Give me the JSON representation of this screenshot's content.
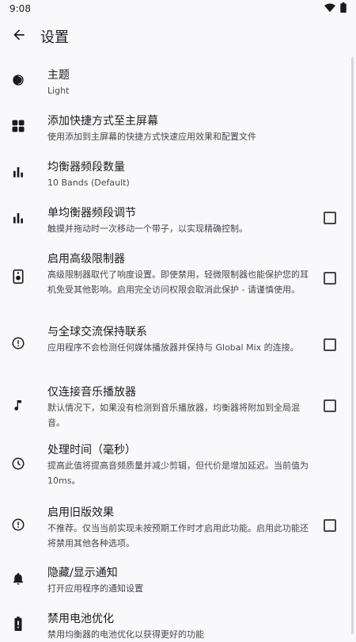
{
  "status_bar": {
    "time": "9:08",
    "wifi_icon": "wifi-icon",
    "battery_icon": "battery-icon"
  },
  "app_bar": {
    "title": "设置",
    "back_icon": "arrow-back-icon"
  },
  "settings": [
    {
      "icon": "theme-contrast-icon",
      "title": "主题",
      "subtitle": "Light",
      "checkbox": false
    },
    {
      "icon": "grid-icon",
      "title": "添加快捷方式至主屏幕",
      "subtitle": "使用添加到主屏幕的快捷方式快速应用效果和配置文件",
      "checkbox": false
    },
    {
      "icon": "bar-chart-icon",
      "title": "均衡器频段数量",
      "subtitle": "10 Bands (Default)",
      "checkbox": false
    },
    {
      "icon": "bar-chart-icon",
      "title": "单均衡器频段调节",
      "subtitle": "触摸并拖动时一次移动一个带子，以实现精确控制。",
      "checkbox": true,
      "checked": false
    },
    {
      "icon": "speaker-icon",
      "title": "启用高级限制器",
      "subtitle": "高级限制器取代了响度设置。即使禁用，轻微限制器也能保护您的耳机免受其他影响。启用完全访问权限会取消此保护 - 请谨慎使用。",
      "checkbox": true,
      "checked": false
    },
    {
      "icon": "info-circle-icon",
      "title": "与全球交流保持联系",
      "subtitle": "应用程序不会检测任何媒体播放器并保持与 Global Mix 的连接。",
      "checkbox": true,
      "checked": false
    },
    {
      "icon": "music-note-icon",
      "title": "仅连接音乐播放器",
      "subtitle": "默认情况下，如果没有检测到音乐播放器，均衡器将附加到全局混音。",
      "checkbox": true,
      "checked": false
    },
    {
      "icon": "clock-icon",
      "title": "处理时间（毫秒）",
      "subtitle": "提高此值将提高音频质量并减少剪辑，但代价是增加延迟。当前值为 10ms。",
      "checkbox": false
    },
    {
      "icon": "info-circle-icon",
      "title": "启用旧版效果",
      "subtitle": "不推荐。仅当当前实现未按预期工作时才启用此功能。启用此功能还将禁用其他各种选项。",
      "checkbox": true,
      "checked": false
    },
    {
      "icon": "bell-icon",
      "title": "隐藏/显示通知",
      "subtitle": "打开应用程序的通知设置",
      "checkbox": false
    },
    {
      "icon": "battery-icon",
      "title": "禁用电池优化",
      "subtitle": "禁用均衡器的电池优化以获得更好的功能",
      "checkbox": false
    }
  ]
}
